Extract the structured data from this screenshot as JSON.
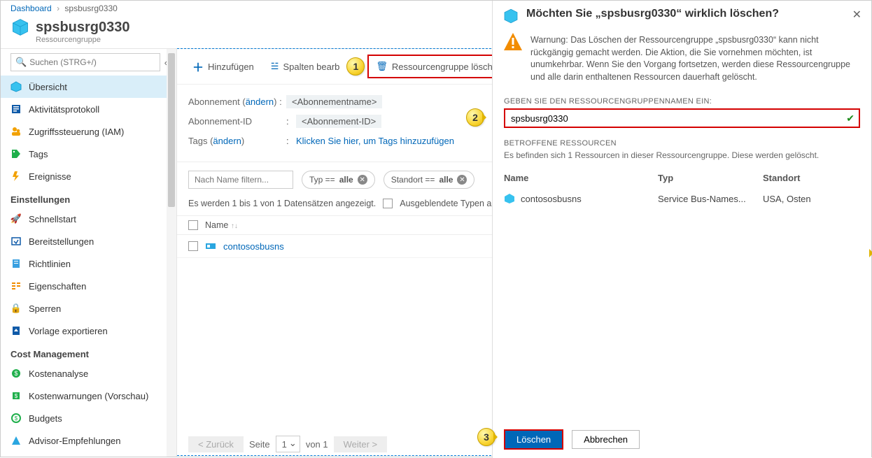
{
  "breadcrumb": {
    "root": "Dashboard",
    "current": "spsbusrg0330"
  },
  "header": {
    "title": "spsbusrg0330",
    "subtitle": "Ressourcengruppe"
  },
  "sidebar": {
    "search_placeholder": "Suchen (STRG+/)",
    "items": [
      {
        "label": "Übersicht"
      },
      {
        "label": "Aktivitätsprotokoll"
      },
      {
        "label": "Zugriffssteuerung (IAM)"
      },
      {
        "label": "Tags"
      },
      {
        "label": "Ereignisse"
      }
    ],
    "section_settings": "Einstellungen",
    "settings": [
      {
        "label": "Schnellstart"
      },
      {
        "label": "Bereitstellungen"
      },
      {
        "label": "Richtlinien"
      },
      {
        "label": "Eigenschaften"
      },
      {
        "label": "Sperren"
      },
      {
        "label": "Vorlage exportieren"
      }
    ],
    "section_cost": "Cost Management",
    "cost": [
      {
        "label": "Kostenanalyse"
      },
      {
        "label": "Kostenwarnungen (Vorschau)"
      },
      {
        "label": "Budgets"
      },
      {
        "label": "Advisor-Empfehlungen"
      }
    ]
  },
  "toolbar": {
    "add": "Hinzufügen",
    "edit_columns": "Spalten bearb",
    "delete_rg": "Ressourcengruppe löschen"
  },
  "callouts": {
    "c1": "1",
    "c2": "2",
    "c3": "3"
  },
  "props": {
    "sub_label": "Abonnement",
    "change": "ändern",
    "sub_value": "<Abonnementname>",
    "subid_label": "Abonnement-ID",
    "subid_value": "<Abonnement-ID>",
    "tags_label": "Tags",
    "tags_link": "Klicken Sie hier, um Tags hinzuzufügen"
  },
  "filters": {
    "name_placeholder": "Nach Name filtern...",
    "type_label": "Typ ==",
    "type_value": "alle",
    "loc_label": "Standort ==",
    "loc_value": "alle"
  },
  "status": {
    "count_text": "Es werden 1 bis 1 von 1 Datensätzen angezeigt.",
    "hidden_types": "Ausgeblendete Typen a"
  },
  "table": {
    "head_name": "Name",
    "sort_glyph": "↑↓",
    "rows": [
      {
        "name": "contososbusns"
      }
    ]
  },
  "pager": {
    "back": "< Zurück",
    "page_label": "Seite",
    "page": "1",
    "of": "von 1",
    "next": "Weiter >"
  },
  "panel": {
    "title": "Möchten Sie „spsbusrg0330“ wirklich löschen?",
    "warning": "Warnung: Das Löschen der Ressourcengruppe „spsbusrg0330“ kann nicht rückgängig gemacht werden. Die Aktion, die Sie vornehmen möchten, ist unumkehrbar. Wenn Sie den Vorgang fortsetzen, werden diese Ressourcengruppe und alle darin enthaltenen Ressourcen dauerhaft gelöscht.",
    "input_label": "GEBEN SIE DEN RESSOURCENGRUPPENNAMEN EIN:",
    "input_value": "spsbusrg0330",
    "affected_heading": "BETROFFENE RESSOURCEN",
    "affected_text": "Es befinden sich 1 Ressourcen in dieser Ressourcengruppe. Diese werden gelöscht.",
    "col_name": "Name",
    "col_type": "Typ",
    "col_loc": "Standort",
    "rows": [
      {
        "name": "contososbusns",
        "type": "Service Bus-Names...",
        "loc": "USA, Osten"
      }
    ],
    "btn_delete": "Löschen",
    "btn_cancel": "Abbrechen"
  }
}
